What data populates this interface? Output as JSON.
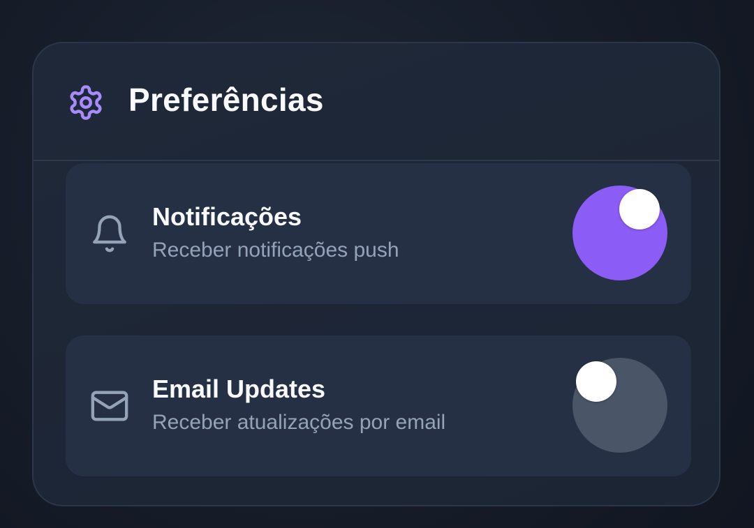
{
  "panel": {
    "title": "Preferências",
    "icon": "gear-icon",
    "accent_color": "#8b5cf6"
  },
  "settings": [
    {
      "icon": "bell-icon",
      "title": "Notificações",
      "description": "Receber notificações push",
      "enabled": true
    },
    {
      "icon": "envelope-icon",
      "title": "Email Updates",
      "description": "Receber atualizações por email",
      "enabled": false
    }
  ],
  "colors": {
    "toggle_on": "#8b5cf6",
    "toggle_off": "#4a5567"
  }
}
